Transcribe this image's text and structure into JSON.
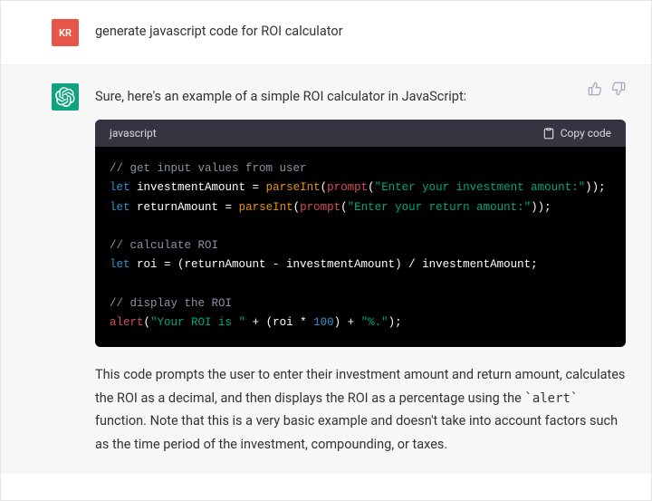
{
  "user": {
    "avatar_initials": "KR",
    "message": "generate javascript code for ROI calculator"
  },
  "assistant": {
    "intro": "Sure, here's an example of a simple ROI calculator in JavaScript:",
    "code": {
      "language_label": "javascript",
      "copy_label": "Copy code",
      "lines": {
        "c1": "// get input values from user",
        "l2_let": "let",
        "l2_var": " investmentAmount ",
        "l2_eq": "= ",
        "l2_fn": "parseInt",
        "l2_pr": "prompt",
        "l2_str": "\"Enter your investment amount:\"",
        "l3_let": "let",
        "l3_var": " returnAmount ",
        "l3_eq": "= ",
        "l3_fn": "parseInt",
        "l3_pr": "prompt",
        "l3_str": "\"Enter your return amount:\"",
        "c2": "// calculate ROI",
        "l5_let": "let",
        "l5_rest": " roi = (returnAmount - investmentAmount) / investmentAmount;",
        "c3": "// display the ROI",
        "l7_fn": "alert",
        "l7_s1": "\"Your ROI is \"",
        "l7_plus1": " + (roi * ",
        "l7_num": "100",
        "l7_plus2": ") + ",
        "l7_s2": "\"%.\"",
        "l7_end": ");"
      }
    },
    "explanation_pre": "This code prompts the user to enter their investment amount and return amount, calculates the ROI as a decimal, and then displays the ROI as a percentage using the ",
    "explanation_code": "`alert`",
    "explanation_post": " function. Note that this is a very basic example and doesn't take into account factors such as the time period of the investment, compounding, or taxes."
  }
}
